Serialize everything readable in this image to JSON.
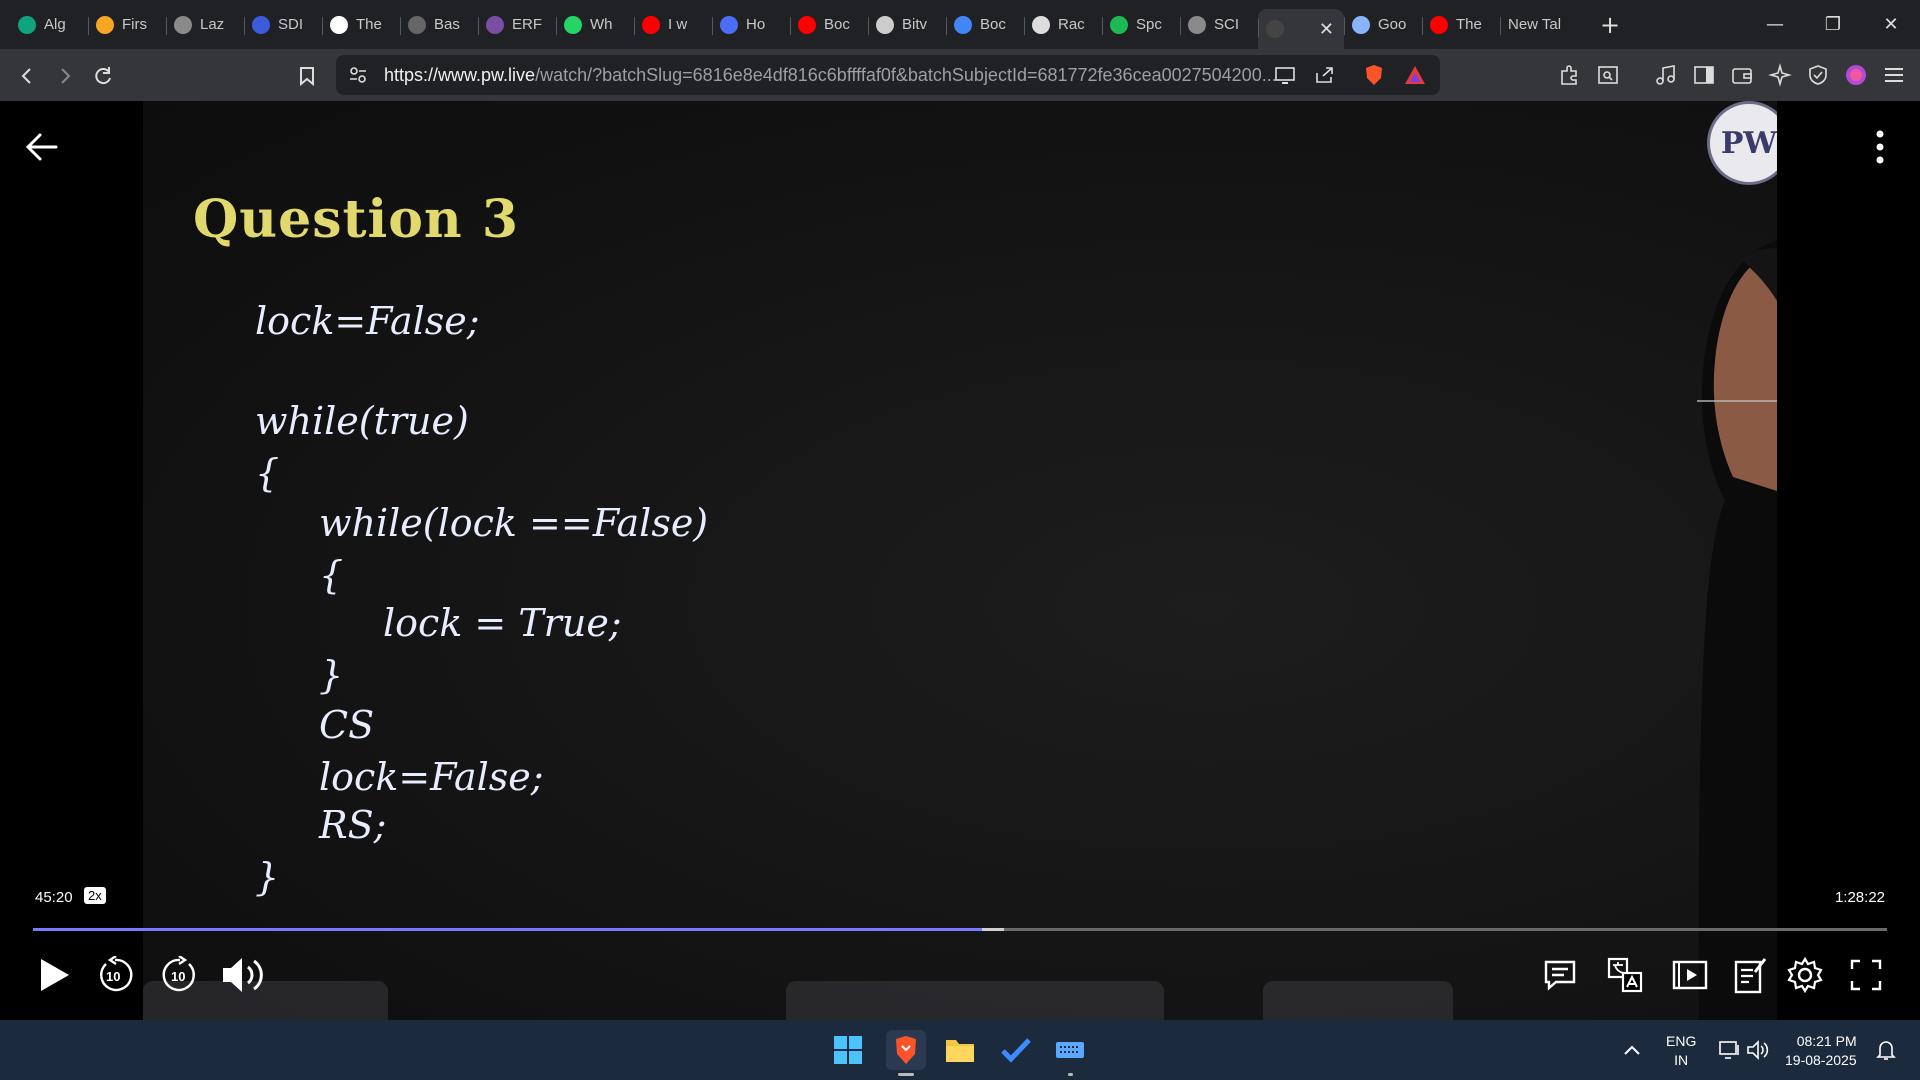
{
  "browser": {
    "tabs": [
      {
        "title": "Alg",
        "icon": "chatgpt-icon",
        "color": "#10a37f"
      },
      {
        "title": "Firs",
        "icon": "lightning-icon",
        "color": "#f5a623"
      },
      {
        "title": "Laz",
        "icon": "globe-icon",
        "color": "#8a8a8a"
      },
      {
        "title": "SDI",
        "icon": "sdi-logo-icon",
        "color": "#3b5bdb"
      },
      {
        "title": "The",
        "icon": "w3schools-icon",
        "color": "#ffffff"
      },
      {
        "title": "Bas",
        "icon": "document-icon",
        "color": "#666666"
      },
      {
        "title": "ERF",
        "icon": "erf-logo-icon",
        "color": "#7b4ea3"
      },
      {
        "title": "Wh",
        "icon": "whatsapp-icon",
        "color": "#25d366"
      },
      {
        "title": "I w",
        "icon": "youtube-icon",
        "color": "#ff0000"
      },
      {
        "title": "Ho",
        "icon": "bookmark-logo-icon",
        "color": "#4c6ef5"
      },
      {
        "title": "Boc",
        "icon": "youtube-icon",
        "color": "#ff0000"
      },
      {
        "title": "Bitv",
        "icon": "bitwarden-icon",
        "color": "#cccccc"
      },
      {
        "title": "Boc",
        "icon": "google-icon",
        "color": "#4285f4"
      },
      {
        "title": "Rac",
        "icon": "openai-icon",
        "color": "#dddddd"
      },
      {
        "title": "Spc",
        "icon": "spotify-icon",
        "color": "#1db954"
      },
      {
        "title": "SCI",
        "icon": "globe-icon",
        "color": "#8a8a8a"
      },
      {
        "title": "",
        "icon": "pw-logo-icon",
        "color": "#444444",
        "active": true
      },
      {
        "title": "Goo",
        "icon": "gemini-icon",
        "color": "#8ab4f8"
      },
      {
        "title": "The",
        "icon": "youtube-icon",
        "color": "#ff0000"
      },
      {
        "title": "New Tal",
        "icon": "",
        "color": ""
      }
    ],
    "url_host": "https://www.pw.live",
    "url_rest": "/watch/?batchSlug=6816e8e4df816c6bffffaf0f&batchSubjectId=681772fe36cea0027504200..."
  },
  "video": {
    "question_title": "Question 3",
    "code_lines": [
      "lock=False;",
      "while(true)",
      "{",
      "while(lock ==False)",
      "{",
      "lock = True;",
      "}",
      "CS",
      "lock=False;",
      "RS;",
      "}"
    ],
    "logo_text": "PW"
  },
  "player": {
    "current_time": "45:20",
    "speed": "2x",
    "duration": "1:28:22",
    "progress_fraction": 0.512,
    "buffered_fraction": 0.524,
    "skip_back_seconds": "10",
    "skip_forward_seconds": "10",
    "progress_color": "#7b79ff"
  },
  "taskbar": {
    "language_line1": "ENG",
    "language_line2": "IN",
    "time": "08:21 PM",
    "date": "19-08-2025"
  }
}
